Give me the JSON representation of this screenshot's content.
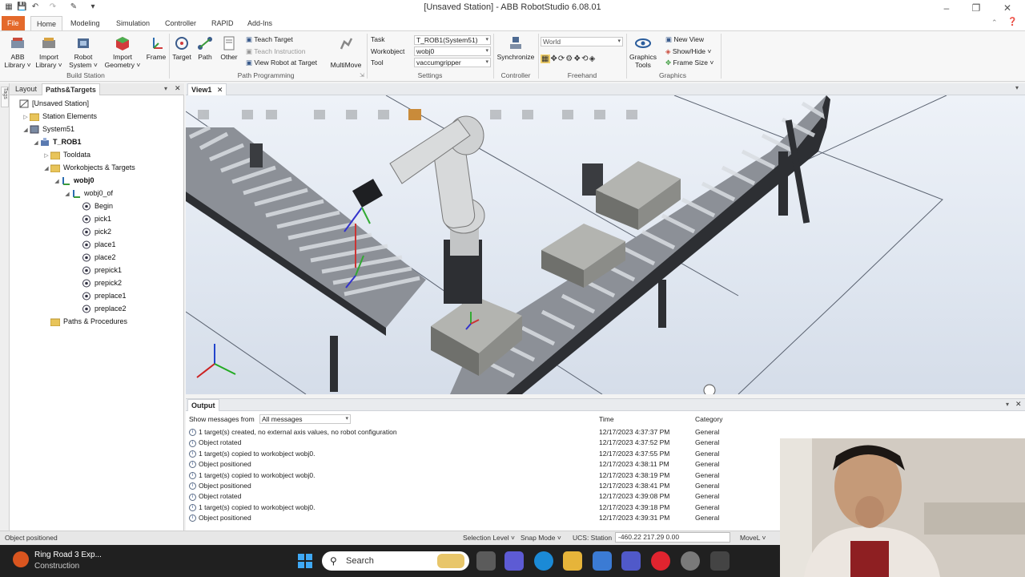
{
  "window": {
    "title": "[Unsaved Station] - ABB RobotStudio 6.08.01"
  },
  "menu_tabs": [
    "File",
    "Home",
    "Modeling",
    "Simulation",
    "Controller",
    "RAPID",
    "Add-Ins"
  ],
  "ribbon": {
    "build_station": {
      "label": "Build Station",
      "buttons": [
        {
          "l1": "ABB",
          "l2": "Library ˅"
        },
        {
          "l1": "Import",
          "l2": "Library ˅"
        },
        {
          "l1": "Robot",
          "l2": "System ˅"
        },
        {
          "l1": "Import",
          "l2": "Geometry ˅"
        },
        {
          "l1": "Frame",
          "l2": ""
        }
      ]
    },
    "path_programming": {
      "label": "Path Programming",
      "buttons": [
        "Target",
        "Path",
        "Other"
      ],
      "small": [
        "Teach Target",
        "Teach Instruction",
        "View Robot at Target"
      ],
      "multimove": "MultiMove"
    },
    "settings": {
      "label": "Settings",
      "task_label": "Task",
      "task_value": "T_ROB1(System51)",
      "workobject_label": "Workobject",
      "workobject_value": "wobj0",
      "tool_label": "Tool",
      "tool_value": "vaccumgripper"
    },
    "controller": {
      "label": "Controller",
      "button": "Synchronize"
    },
    "freehand": {
      "label": "Freehand",
      "frame_value": "World"
    },
    "graphics": {
      "label": "Graphics",
      "button_l1": "Graphics",
      "button_l2": "Tools",
      "small": [
        "New View",
        "Show/Hide ˅",
        "Frame Size ˅"
      ]
    }
  },
  "left_panel": {
    "tabs": [
      "Layout",
      "Paths&Targets"
    ],
    "vertical_tab": "Tags",
    "tree": [
      {
        "label": "[Unsaved Station]",
        "indent": 0,
        "toggle": "",
        "icon": "station-icon",
        "bold": false
      },
      {
        "label": "Station Elements",
        "indent": 1,
        "toggle": "▷",
        "icon": "folder-icon",
        "bold": false
      },
      {
        "label": "System51",
        "indent": 1,
        "toggle": "◢",
        "icon": "system-icon",
        "bold": false
      },
      {
        "label": "T_ROB1",
        "indent": 2,
        "toggle": "◢",
        "icon": "robot-task-icon",
        "bold": true
      },
      {
        "label": "Tooldata",
        "indent": 3,
        "toggle": "▷",
        "icon": "folder-icon",
        "bold": false
      },
      {
        "label": "Workobjects & Targets",
        "indent": 3,
        "toggle": "◢",
        "icon": "folder-icon",
        "bold": false
      },
      {
        "label": "wobj0",
        "indent": 4,
        "toggle": "◢",
        "icon": "workobject-icon",
        "bold": true
      },
      {
        "label": "wobj0_of",
        "indent": 5,
        "toggle": "◢",
        "icon": "workobject-icon",
        "bold": false
      },
      {
        "label": "Begin",
        "indent": 6,
        "toggle": "",
        "icon": "target-icon",
        "bold": false
      },
      {
        "label": "pick1",
        "indent": 6,
        "toggle": "",
        "icon": "target-icon",
        "bold": false
      },
      {
        "label": "pick2",
        "indent": 6,
        "toggle": "",
        "icon": "target-icon",
        "bold": false
      },
      {
        "label": "place1",
        "indent": 6,
        "toggle": "",
        "icon": "target-icon",
        "bold": false
      },
      {
        "label": "place2",
        "indent": 6,
        "toggle": "",
        "icon": "target-icon",
        "bold": false
      },
      {
        "label": "prepick1",
        "indent": 6,
        "toggle": "",
        "icon": "target-icon",
        "bold": false
      },
      {
        "label": "prepick2",
        "indent": 6,
        "toggle": "",
        "icon": "target-icon",
        "bold": false
      },
      {
        "label": "preplace1",
        "indent": 6,
        "toggle": "",
        "icon": "target-icon",
        "bold": false
      },
      {
        "label": "preplace2",
        "indent": 6,
        "toggle": "",
        "icon": "target-icon",
        "bold": false
      },
      {
        "label": "Paths & Procedures",
        "indent": 3,
        "toggle": "",
        "icon": "folder-icon",
        "bold": false
      }
    ]
  },
  "view": {
    "tab": "View1"
  },
  "output": {
    "title": "Output",
    "filter_label": "Show messages from",
    "filter_value": "All messages",
    "col_time": "Time",
    "col_category": "Category",
    "rows": [
      {
        "msg": "1 target(s) created, no external axis values, no robot configuration",
        "time": "12/17/2023 4:37:37 PM",
        "cat": "General"
      },
      {
        "msg": "Object rotated",
        "time": "12/17/2023 4:37:52 PM",
        "cat": "General"
      },
      {
        "msg": "1 target(s) copied to workobject wobj0.",
        "time": "12/17/2023 4:37:55 PM",
        "cat": "General"
      },
      {
        "msg": "Object positioned",
        "time": "12/17/2023 4:38:11 PM",
        "cat": "General"
      },
      {
        "msg": "1 target(s) copied to workobject wobj0.",
        "time": "12/17/2023 4:38:19 PM",
        "cat": "General"
      },
      {
        "msg": "Object positioned",
        "time": "12/17/2023 4:38:41 PM",
        "cat": "General"
      },
      {
        "msg": "Object rotated",
        "time": "12/17/2023 4:39:08 PM",
        "cat": "General"
      },
      {
        "msg": "1 target(s) copied to workobject wobj0.",
        "time": "12/17/2023 4:39:18 PM",
        "cat": "General"
      },
      {
        "msg": "Object positioned",
        "time": "12/17/2023 4:39:31 PM",
        "cat": "General"
      }
    ]
  },
  "status": {
    "message": "Object positioned",
    "selection_level": "Selection Level ˅",
    "snap_mode": "Snap Mode ˅",
    "ucs": "UCS: Station",
    "coords": "-460.22  217.29  0.00",
    "move_mode": "MoveL ˅"
  },
  "taskbar": {
    "weather_title": "Ring Road 3 Exp...",
    "weather_sub": "Construction",
    "search_placeholder": "Search"
  }
}
